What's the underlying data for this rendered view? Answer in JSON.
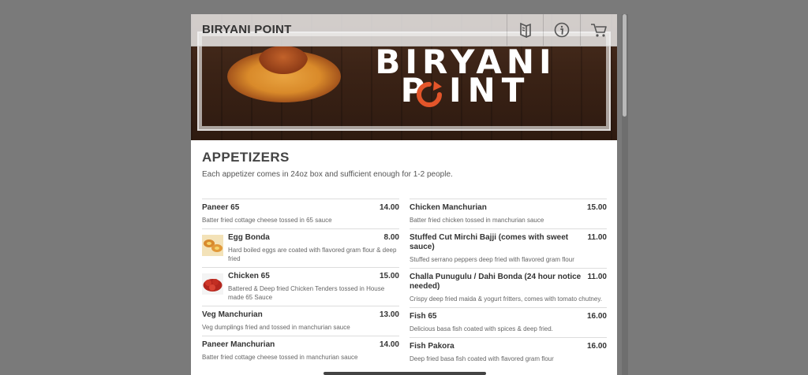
{
  "header": {
    "title": "BIRYANI POINT",
    "icons": [
      "menu-book-icon",
      "info-icon",
      "cart-icon"
    ]
  },
  "banner": {
    "logo_line1": "BIRYANI",
    "logo_line2": "P INT",
    "logo_accent_color": "#e3552a"
  },
  "section": {
    "title": "APPETIZERS",
    "description": "Each appetizer comes in 24oz box and sufficient enough for 1-2 people."
  },
  "menu": {
    "left": [
      {
        "name": "Paneer 65",
        "price": "14.00",
        "desc": "Batter fried cottage cheese tossed in 65 sauce",
        "thumb": ""
      },
      {
        "name": "Egg Bonda",
        "price": "8.00",
        "desc": "Hard boiled eggs are coated with flavored gram flour & deep fried",
        "thumb": "egg-bonda-image"
      },
      {
        "name": "Chicken 65",
        "price": "15.00",
        "desc": "Battered & Deep fried Chicken Tenders tossed in House made 65 Sauce",
        "thumb": "chicken-65-image"
      },
      {
        "name": "Veg Manchurian",
        "price": "13.00",
        "desc": "Veg dumplings fried and tossed in manchurian sauce",
        "thumb": ""
      },
      {
        "name": "Paneer Manchurian",
        "price": "14.00",
        "desc": "Batter fried cottage cheese tossed in manchurian sauce",
        "thumb": ""
      }
    ],
    "right": [
      {
        "name": "Chicken Manchurian",
        "price": "15.00",
        "desc": "Batter fried chicken tossed in manchurian sauce"
      },
      {
        "name": "Stuffed Cut Mirchi Bajji (comes with sweet sauce)",
        "price": "11.00",
        "desc": "Stuffed serrano peppers deep fried with flavored gram flour"
      },
      {
        "name": "Challa Punugulu / Dahi Bonda (24 hour notice needed)",
        "price": "11.00",
        "desc": "Crispy deep fried maida & yogurt fritters, comes with tomato chutney."
      },
      {
        "name": "Fish 65",
        "price": "16.00",
        "desc": "Delicious basa fish coated with spices & deep fried."
      },
      {
        "name": "Fish Pakora",
        "price": "16.00",
        "desc": "Deep fried basa fish coated with flavored gram flour"
      }
    ]
  },
  "colors": {
    "background": "#7a7a7a",
    "panel": "#ffffff",
    "text": "#333333"
  }
}
